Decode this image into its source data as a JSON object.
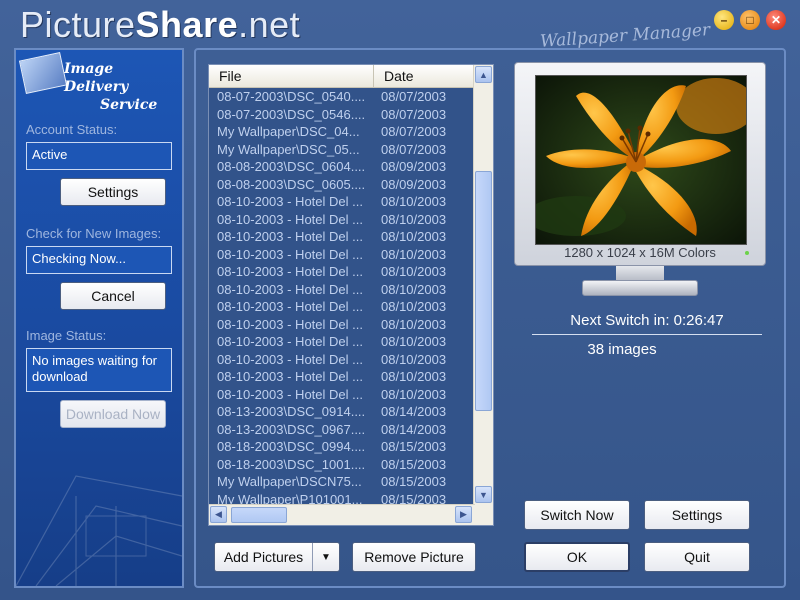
{
  "brand": {
    "name_light": "Picture",
    "name_bold": "Share",
    "name_suffix": ".net"
  },
  "window_controls": {
    "minimize": "–",
    "maximize": "□",
    "close": "✕"
  },
  "app_title": "Wallpaper Manager",
  "sidebar": {
    "logo_line1": "Image Delivery",
    "logo_line2": "Service",
    "account_status_label": "Account Status:",
    "account_status_value": "Active",
    "settings_button": "Settings",
    "check_images_label": "Check for New Images:",
    "check_images_value": "Checking Now...",
    "cancel_button": "Cancel",
    "image_status_label": "Image Status:",
    "image_status_value": "No images waiting for download",
    "download_button": "Download Now"
  },
  "file_list": {
    "columns": [
      "File",
      "Date"
    ],
    "rows": [
      {
        "file": "08-07-2003\\DSC_0540....",
        "date": "08/07/2003"
      },
      {
        "file": "08-07-2003\\DSC_0546....",
        "date": "08/07/2003"
      },
      {
        "file": "My Wallpaper\\DSC_04...",
        "date": "08/07/2003"
      },
      {
        "file": "My Wallpaper\\DSC_05...",
        "date": "08/07/2003"
      },
      {
        "file": "08-08-2003\\DSC_0604....",
        "date": "08/09/2003"
      },
      {
        "file": "08-08-2003\\DSC_0605....",
        "date": "08/09/2003"
      },
      {
        "file": "08-10-2003 - Hotel Del ...",
        "date": "08/10/2003"
      },
      {
        "file": "08-10-2003 - Hotel Del ...",
        "date": "08/10/2003"
      },
      {
        "file": "08-10-2003 - Hotel Del ...",
        "date": "08/10/2003"
      },
      {
        "file": "08-10-2003 - Hotel Del ...",
        "date": "08/10/2003"
      },
      {
        "file": "08-10-2003 - Hotel Del ...",
        "date": "08/10/2003"
      },
      {
        "file": "08-10-2003 - Hotel Del ...",
        "date": "08/10/2003"
      },
      {
        "file": "08-10-2003 - Hotel Del ...",
        "date": "08/10/2003"
      },
      {
        "file": "08-10-2003 - Hotel Del ...",
        "date": "08/10/2003"
      },
      {
        "file": "08-10-2003 - Hotel Del ...",
        "date": "08/10/2003"
      },
      {
        "file": "08-10-2003 - Hotel Del ...",
        "date": "08/10/2003"
      },
      {
        "file": "08-10-2003 - Hotel Del ...",
        "date": "08/10/2003"
      },
      {
        "file": "08-10-2003 - Hotel Del ...",
        "date": "08/10/2003"
      },
      {
        "file": "08-13-2003\\DSC_0914....",
        "date": "08/14/2003"
      },
      {
        "file": "08-13-2003\\DSC_0967....",
        "date": "08/14/2003"
      },
      {
        "file": "08-18-2003\\DSC_0994....",
        "date": "08/15/2003"
      },
      {
        "file": "08-18-2003\\DSC_1001....",
        "date": "08/15/2003"
      },
      {
        "file": "My Wallpaper\\DSCN75...",
        "date": "08/15/2003"
      },
      {
        "file": "My Wallpaper\\P101001...",
        "date": "08/15/2003"
      }
    ]
  },
  "preview": {
    "resolution": "1280 x 1024 x 16M Colors"
  },
  "status": {
    "next_switch": "Next Switch in: 0:26:47",
    "image_count": "38 images"
  },
  "buttons": {
    "add_pictures": "Add Pictures",
    "remove_picture": "Remove Picture",
    "switch_now": "Switch Now",
    "settings": "Settings",
    "ok": "OK",
    "quit": "Quit"
  },
  "colors": {
    "accent": "#1d56b5",
    "background": "#3b5a8c",
    "flower": "#f7a21c"
  }
}
